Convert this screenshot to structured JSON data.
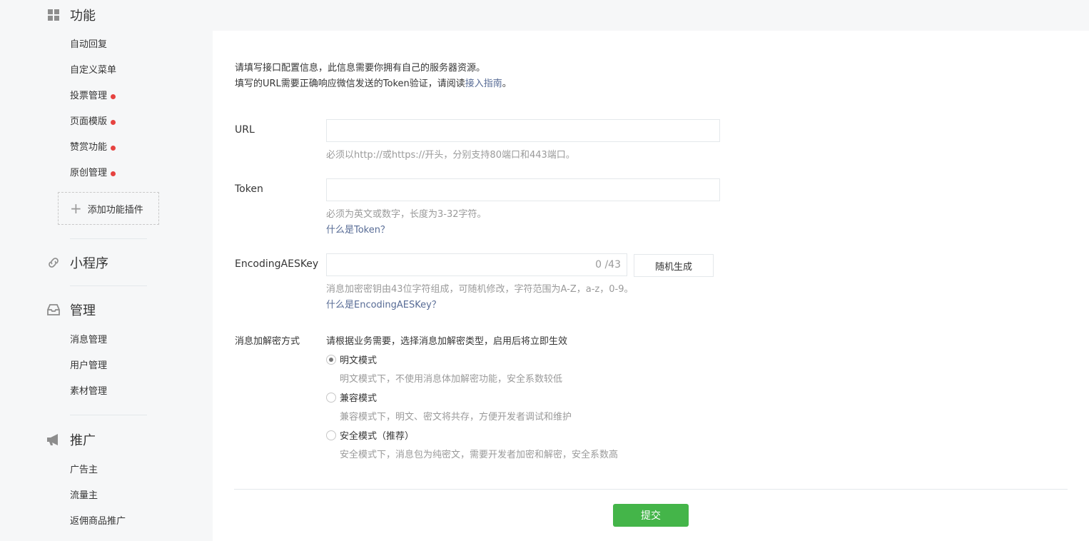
{
  "sidebar": {
    "features": {
      "title": "功能",
      "icon": "grid-icon",
      "items": [
        {
          "label": "自动回复",
          "dot": false
        },
        {
          "label": "自定义菜单",
          "dot": false
        },
        {
          "label": "投票管理",
          "dot": true
        },
        {
          "label": "页面模版",
          "dot": true
        },
        {
          "label": "赞赏功能",
          "dot": true
        },
        {
          "label": "原创管理",
          "dot": true
        }
      ],
      "add_plugin": "添加功能插件"
    },
    "miniprogram": {
      "title": "小程序",
      "icon": "link-icon"
    },
    "manage": {
      "title": "管理",
      "icon": "inbox-icon",
      "items": [
        "消息管理",
        "用户管理",
        "素材管理"
      ]
    },
    "promote": {
      "title": "推广",
      "icon": "megaphone-icon",
      "items": [
        "广告主",
        "流量主",
        "返佣商品推广"
      ]
    }
  },
  "main": {
    "intro_line1": "请填写接口配置信息，此信息需要你拥有自己的服务器资源。",
    "intro_line2_prefix": "填写的URL需要正确响应微信发送的Token验证，请阅读",
    "intro_link": "接入指南",
    "intro_line2_suffix": "。",
    "url": {
      "label": "URL",
      "value": "",
      "tip": "必须以http://或https://开头，分别支持80端口和443端口。"
    },
    "token": {
      "label": "Token",
      "value": "",
      "tip": "必须为英文或数字，长度为3-32字符。",
      "link": "什么是Token？"
    },
    "aeskey": {
      "label": "EncodingAESKey",
      "value": "",
      "counter": "0 /43",
      "random_button": "随机生成",
      "tip": "消息加密密钥由43位字符组成，可随机修改，字符范围为A-Z，a-z，0-9。",
      "link": "什么是EncodingAESKey？"
    },
    "encrypt": {
      "label": "消息加解密方式",
      "hint": "请根据业务需要，选择消息加解密类型，启用后将立即生效",
      "options": [
        {
          "label": "明文模式",
          "desc": "明文模式下，不使用消息体加解密功能，安全系数较低",
          "selected": true
        },
        {
          "label": "兼容模式",
          "desc": "兼容模式下，明文、密文将共存，方便开发者调试和维护",
          "selected": false
        },
        {
          "label": "安全模式（推荐）",
          "desc": "安全模式下，消息包为纯密文，需要开发者加密和解密，安全系数高",
          "selected": false
        }
      ]
    },
    "submit": "提交"
  },
  "colors": {
    "accent_green": "#44b549",
    "link_blue": "#576b95",
    "dot_red": "#e64340",
    "sidebar_bg": "#f6f7f8"
  }
}
